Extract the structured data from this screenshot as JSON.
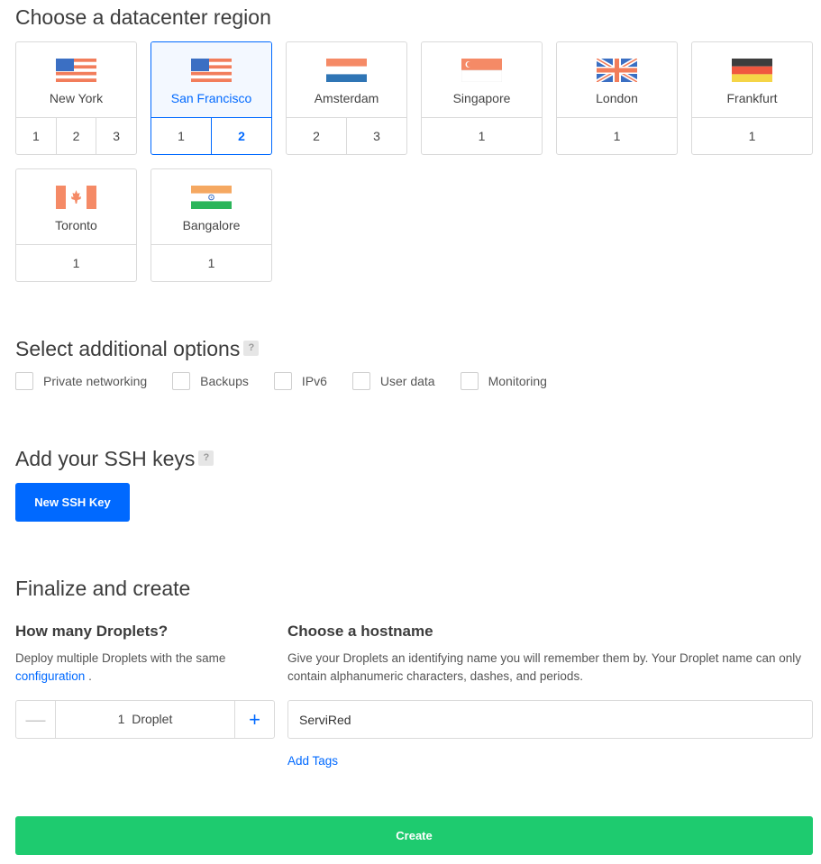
{
  "region_section": {
    "title": "Choose a datacenter region",
    "regions": [
      {
        "name": "New York",
        "flag": "us-flag",
        "numbers": [
          "1",
          "2",
          "3"
        ],
        "selected": false
      },
      {
        "name": "San Francisco",
        "flag": "us-flag",
        "numbers": [
          "1",
          "2"
        ],
        "selected": true,
        "active_number": "2"
      },
      {
        "name": "Amsterdam",
        "flag": "nl-flag",
        "numbers": [
          "2",
          "3"
        ],
        "selected": false
      },
      {
        "name": "Singapore",
        "flag": "sg-flag",
        "numbers": [
          "1"
        ],
        "selected": false
      },
      {
        "name": "London",
        "flag": "uk-flag",
        "numbers": [
          "1"
        ],
        "selected": false
      },
      {
        "name": "Frankfurt",
        "flag": "de-flag",
        "numbers": [
          "1"
        ],
        "selected": false
      },
      {
        "name": "Toronto",
        "flag": "ca-flag",
        "numbers": [
          "1"
        ],
        "selected": false
      },
      {
        "name": "Bangalore",
        "flag": "in-flag",
        "numbers": [
          "1"
        ],
        "selected": false
      }
    ]
  },
  "options_section": {
    "title": "Select additional options",
    "help": "?",
    "options": [
      {
        "label": "Private networking",
        "checked": false
      },
      {
        "label": "Backups",
        "checked": false
      },
      {
        "label": "IPv6",
        "checked": false
      },
      {
        "label": "User data",
        "checked": false
      },
      {
        "label": "Monitoring",
        "checked": false
      }
    ]
  },
  "ssh_section": {
    "title": "Add your SSH keys",
    "help": "?",
    "button_label": "New SSH Key"
  },
  "finalize_section": {
    "title": "Finalize and create",
    "droplets": {
      "title": "How many Droplets?",
      "description": "Deploy multiple Droplets with the same",
      "link": "configuration",
      "after_link": ".",
      "minus": "—",
      "plus": "+",
      "count_text": "1  Droplet"
    },
    "hostname": {
      "title": "Choose a hostname",
      "description": "Give your Droplets an identifying name you will remember them by. Your Droplet name can only contain alphanumeric characters, dashes, and periods.",
      "value": "ServiRed",
      "add_tags": "Add Tags"
    },
    "create_label": "Create"
  },
  "colors": {
    "accent": "#0069ff",
    "create": "#1ecb6f",
    "border": "#dadada"
  }
}
